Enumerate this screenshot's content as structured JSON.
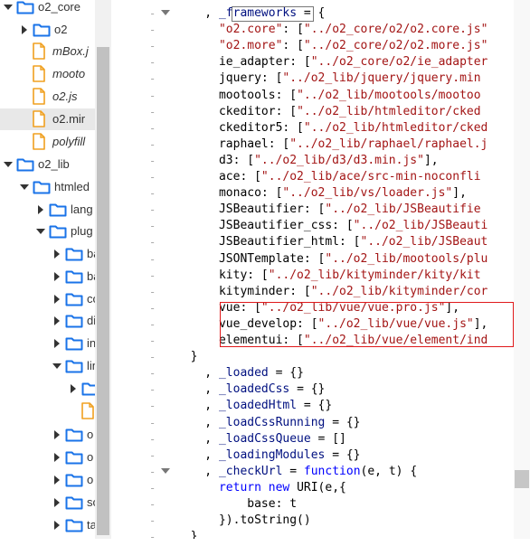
{
  "tree": {
    "items": [
      {
        "label": "o2_core",
        "kind": "folder",
        "twisty": "open"
      },
      {
        "label": "o2",
        "kind": "folder",
        "twisty": "closed"
      },
      {
        "label": "mBox.j",
        "kind": "file",
        "italic": true
      },
      {
        "label": "mooto",
        "kind": "file",
        "italic": true
      },
      {
        "label": "o2.js",
        "kind": "file",
        "italic": true
      },
      {
        "label": "o2.mir",
        "kind": "file",
        "italic": false,
        "selected": true
      },
      {
        "label": "polyfill",
        "kind": "file",
        "italic": true
      },
      {
        "label": "o2_lib",
        "kind": "folder",
        "twisty": "open"
      },
      {
        "label": "htmled",
        "kind": "folder",
        "twisty": "open"
      },
      {
        "label": "lang",
        "kind": "folder",
        "twisty": "closed"
      },
      {
        "label": "plug",
        "kind": "folder",
        "twisty": "open"
      },
      {
        "label": "ba",
        "kind": "folder",
        "twisty": "closed"
      },
      {
        "label": "ba",
        "kind": "folder",
        "twisty": "closed"
      },
      {
        "label": "co",
        "kind": "folder",
        "twisty": "closed"
      },
      {
        "label": "di",
        "kind": "folder",
        "twisty": "closed"
      },
      {
        "label": "in",
        "kind": "folder",
        "twisty": "closed"
      },
      {
        "label": "lin",
        "kind": "folder",
        "twisty": "open"
      },
      {
        "label": "",
        "kind": "folder",
        "twisty": "closed"
      },
      {
        "label": "",
        "kind": "file",
        "italic": false
      },
      {
        "label": "o",
        "kind": "folder",
        "twisty": "closed"
      },
      {
        "label": "o",
        "kind": "folder",
        "twisty": "closed"
      },
      {
        "label": "o",
        "kind": "folder",
        "twisty": "closed"
      },
      {
        "label": "sc",
        "kind": "folder",
        "twisty": "closed"
      },
      {
        "label": "ta",
        "kind": "folder",
        "twisty": "closed"
      }
    ]
  },
  "code": {
    "lines": [
      [
        {
          "t": "    , "
        },
        {
          "t": "_frameworks",
          "c": "p"
        },
        {
          "t": " = {"
        }
      ],
      [
        {
          "t": "      "
        },
        {
          "t": "\"o2.core\"",
          "c": "s"
        },
        {
          "t": ": ["
        },
        {
          "t": "\"../o2_core/o2/o2.core.js\"",
          "c": "s"
        }
      ],
      [
        {
          "t": "      "
        },
        {
          "t": "\"o2.more\"",
          "c": "s"
        },
        {
          "t": ": ["
        },
        {
          "t": "\"../o2_core/o2/o2.more.js\"",
          "c": "s"
        }
      ],
      [
        {
          "t": "      ie_adapter: ["
        },
        {
          "t": "\"../o2_core/o2/ie_adapter",
          "c": "s"
        }
      ],
      [
        {
          "t": "      jquery: ["
        },
        {
          "t": "\"../o2_lib/jquery/jquery.min",
          "c": "s"
        }
      ],
      [
        {
          "t": "      mootools: ["
        },
        {
          "t": "\"../o2_lib/mootools/mootoo",
          "c": "s"
        }
      ],
      [
        {
          "t": "      ckeditor: ["
        },
        {
          "t": "\"../o2_lib/htmleditor/cked",
          "c": "s"
        }
      ],
      [
        {
          "t": "      ckeditor5: ["
        },
        {
          "t": "\"../o2_lib/htmleditor/cked",
          "c": "s"
        }
      ],
      [
        {
          "t": "      raphael: ["
        },
        {
          "t": "\"../o2_lib/raphael/raphael.j",
          "c": "s"
        }
      ],
      [
        {
          "t": "      d3: ["
        },
        {
          "t": "\"../o2_lib/d3/d3.min.js\"",
          "c": "s"
        },
        {
          "t": "],"
        }
      ],
      [
        {
          "t": "      ace: ["
        },
        {
          "t": "\"../o2_lib/ace/src-min-noconfli",
          "c": "s"
        }
      ],
      [
        {
          "t": "      monaco: ["
        },
        {
          "t": "\"../o2_lib/vs/loader.js\"",
          "c": "s"
        },
        {
          "t": "],"
        }
      ],
      [
        {
          "t": "      JSBeautifier: ["
        },
        {
          "t": "\"../o2_lib/JSBeautifie",
          "c": "s"
        }
      ],
      [
        {
          "t": "      JSBeautifier_css: ["
        },
        {
          "t": "\"../o2_lib/JSBeauti",
          "c": "s"
        }
      ],
      [
        {
          "t": "      JSBeautifier_html: ["
        },
        {
          "t": "\"../o2_lib/JSBeaut",
          "c": "s"
        }
      ],
      [
        {
          "t": "      JSONTemplate: ["
        },
        {
          "t": "\"../o2_lib/mootools/plu",
          "c": "s"
        }
      ],
      [
        {
          "t": "      kity: ["
        },
        {
          "t": "\"../o2_lib/kityminder/kity/kit",
          "c": "s"
        }
      ],
      [
        {
          "t": "      kityminder: ["
        },
        {
          "t": "\"../o2_lib/kityminder/cor",
          "c": "s"
        }
      ],
      [
        {
          "t": "      vue: ["
        },
        {
          "t": "\"../o2_lib/vue/vue.pro.js\"",
          "c": "s"
        },
        {
          "t": "],"
        }
      ],
      [
        {
          "t": "      vue_develop: ["
        },
        {
          "t": "\"../o2_lib/vue/vue.js\"",
          "c": "s"
        },
        {
          "t": "],"
        }
      ],
      [
        {
          "t": "      elementui: ["
        },
        {
          "t": "\"../o2_lib/vue/element/ind",
          "c": "s"
        }
      ],
      [
        {
          "t": "  }"
        }
      ],
      [
        {
          "t": "    , "
        },
        {
          "t": "_loaded",
          "c": "p"
        },
        {
          "t": " = {}"
        }
      ],
      [
        {
          "t": "    , "
        },
        {
          "t": "_loadedCss",
          "c": "p"
        },
        {
          "t": " = {}"
        }
      ],
      [
        {
          "t": "    , "
        },
        {
          "t": "_loadedHtml",
          "c": "p"
        },
        {
          "t": " = {}"
        }
      ],
      [
        {
          "t": "    , "
        },
        {
          "t": "_loadCssRunning",
          "c": "p"
        },
        {
          "t": " = {}"
        }
      ],
      [
        {
          "t": "    , "
        },
        {
          "t": "_loadCssQueue",
          "c": "p"
        },
        {
          "t": " = []"
        }
      ],
      [
        {
          "t": "    , "
        },
        {
          "t": "_loadingModules",
          "c": "p"
        },
        {
          "t": " = {}"
        }
      ],
      [
        {
          "t": "    , "
        },
        {
          "t": "_checkUrl",
          "c": "p"
        },
        {
          "t": " = "
        },
        {
          "t": "function",
          "c": "k"
        },
        {
          "t": "(e, t) {"
        }
      ],
      [
        {
          "t": "      "
        },
        {
          "t": "return",
          "c": "k"
        },
        {
          "t": " "
        },
        {
          "t": "new",
          "c": "k"
        },
        {
          "t": " URI(e,{"
        }
      ],
      [
        {
          "t": "          base: t"
        }
      ],
      [
        {
          "t": "      }).toString()"
        }
      ],
      [
        {
          "t": "  }"
        }
      ]
    ]
  },
  "colors": {
    "folder": "#1a73e8",
    "file": "#f0a020",
    "string": "#a31515",
    "keyword": "#0000ff",
    "property": "#001080",
    "highlight_box": "#e0191b"
  },
  "icons": {
    "folder": "folder-icon",
    "file": "file-icon",
    "expand": "chevron-right-icon",
    "collapse": "chevron-down-icon",
    "fold": "fold-arrow-icon"
  }
}
